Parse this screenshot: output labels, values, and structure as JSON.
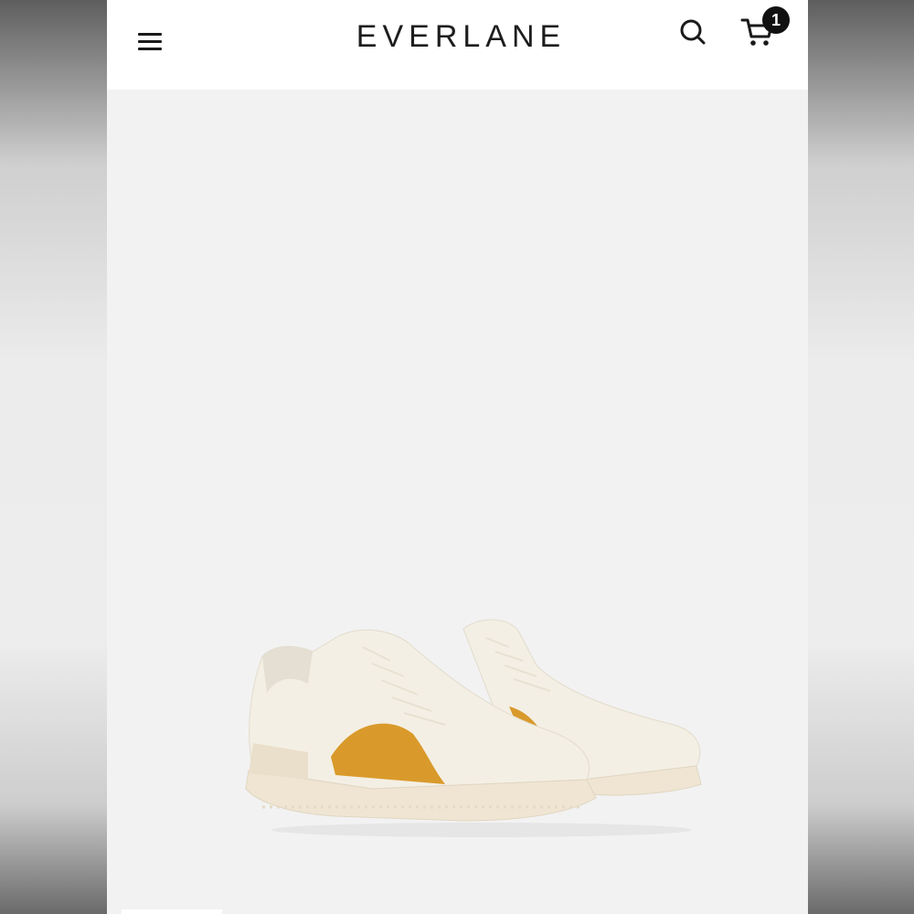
{
  "header": {
    "logo": "EVERLANE",
    "cart_count": "1"
  },
  "icons": {
    "menu": "hamburger-menu-icon",
    "search": "search-icon",
    "cart": "shopping-cart-icon"
  },
  "product": {
    "image": "white-sneakers-with-mustard-suede-panel"
  },
  "colors": {
    "header_bg": "#ffffff",
    "image_bg": "#f2f2f2",
    "accent_suede": "#d99a2b",
    "sneaker_white": "#f4efe4",
    "badge_bg": "#111111"
  }
}
